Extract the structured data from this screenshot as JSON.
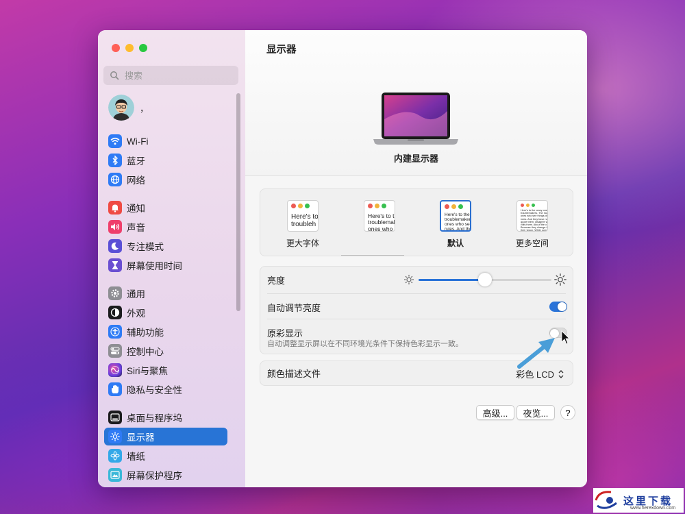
{
  "sidebar": {
    "search_placeholder": "搜索",
    "user_name": "，",
    "items": [
      {
        "label": "Wi-Fi",
        "icon": "wifi-icon",
        "color": "#2f7bf5"
      },
      {
        "label": "蓝牙",
        "icon": "bluetooth-icon",
        "color": "#2f7bf5"
      },
      {
        "label": "网络",
        "icon": "globe-icon",
        "color": "#2f7bf5"
      },
      {
        "label": "通知",
        "icon": "bell-icon",
        "color": "#ef4a43"
      },
      {
        "label": "声音",
        "icon": "speaker-icon",
        "color": "#ef3f6b"
      },
      {
        "label": "专注模式",
        "icon": "moon-icon",
        "color": "#5a4fd6"
      },
      {
        "label": "屏幕使用时间",
        "icon": "hourglass-icon",
        "color": "#6a4fd1"
      },
      {
        "label": "通用",
        "icon": "gear-icon",
        "color": "#8e8e93"
      },
      {
        "label": "外观",
        "icon": "appearance-icon",
        "color": "#1c1c1e"
      },
      {
        "label": "辅助功能",
        "icon": "accessibility-icon",
        "color": "#2f7bf5"
      },
      {
        "label": "控制中心",
        "icon": "control-center-icon",
        "color": "#8e8e93"
      },
      {
        "label": "Siri与聚焦",
        "icon": "siri-icon",
        "color": "#a43fd0"
      },
      {
        "label": "隐私与安全性",
        "icon": "hand-icon",
        "color": "#2f7bf5"
      },
      {
        "label": "桌面与程序坞",
        "icon": "dock-icon",
        "color": "#1c1c1e"
      },
      {
        "label": "显示器",
        "icon": "sun-icon",
        "color": "#2f7bf5",
        "selected": true
      },
      {
        "label": "墙纸",
        "icon": "flower-icon",
        "color": "#33a8e8"
      },
      {
        "label": "屏幕保护程序",
        "icon": "screensaver-icon",
        "color": "#3ab8d8"
      }
    ]
  },
  "main": {
    "title": "显示器",
    "display_name": "内建显示器",
    "resolution_options": [
      {
        "label": "更大字体",
        "preview": "Here's to\ntroubleh",
        "selected": false
      },
      {
        "label": "",
        "preview": "Here's to the\ntroublemakers\nones who see",
        "selected": false
      },
      {
        "label": "默认",
        "preview": "Here's to the c\ntroublemakers.\nones who see t\nrules. And they",
        "selected": true
      },
      {
        "label": "更多空间",
        "preview": "Here's to the crazy ones\ntroublemakers. The rou\nones who see things dif\nrules. And they have no\nquote them, disagree w\nvilify them. About the o\nBecause they change th\ntheir vision. While som",
        "selected": false
      }
    ],
    "brightness_label": "亮度",
    "brightness_value": 0.5,
    "auto_brightness_label": "自动调节亮度",
    "auto_brightness_on": true,
    "true_tone_label": "原彩显示",
    "true_tone_desc": "自动调整显示屏以在不同环境光条件下保持色彩显示一致。",
    "true_tone_on": false,
    "color_profile_label": "颜色描述文件",
    "color_profile_value": "彩色 LCD",
    "advanced_button": "高级...",
    "night_shift_button": "夜览...",
    "help_button": "?"
  },
  "watermark": {
    "text": "这里下载",
    "sub": "www.herexdown.com"
  }
}
